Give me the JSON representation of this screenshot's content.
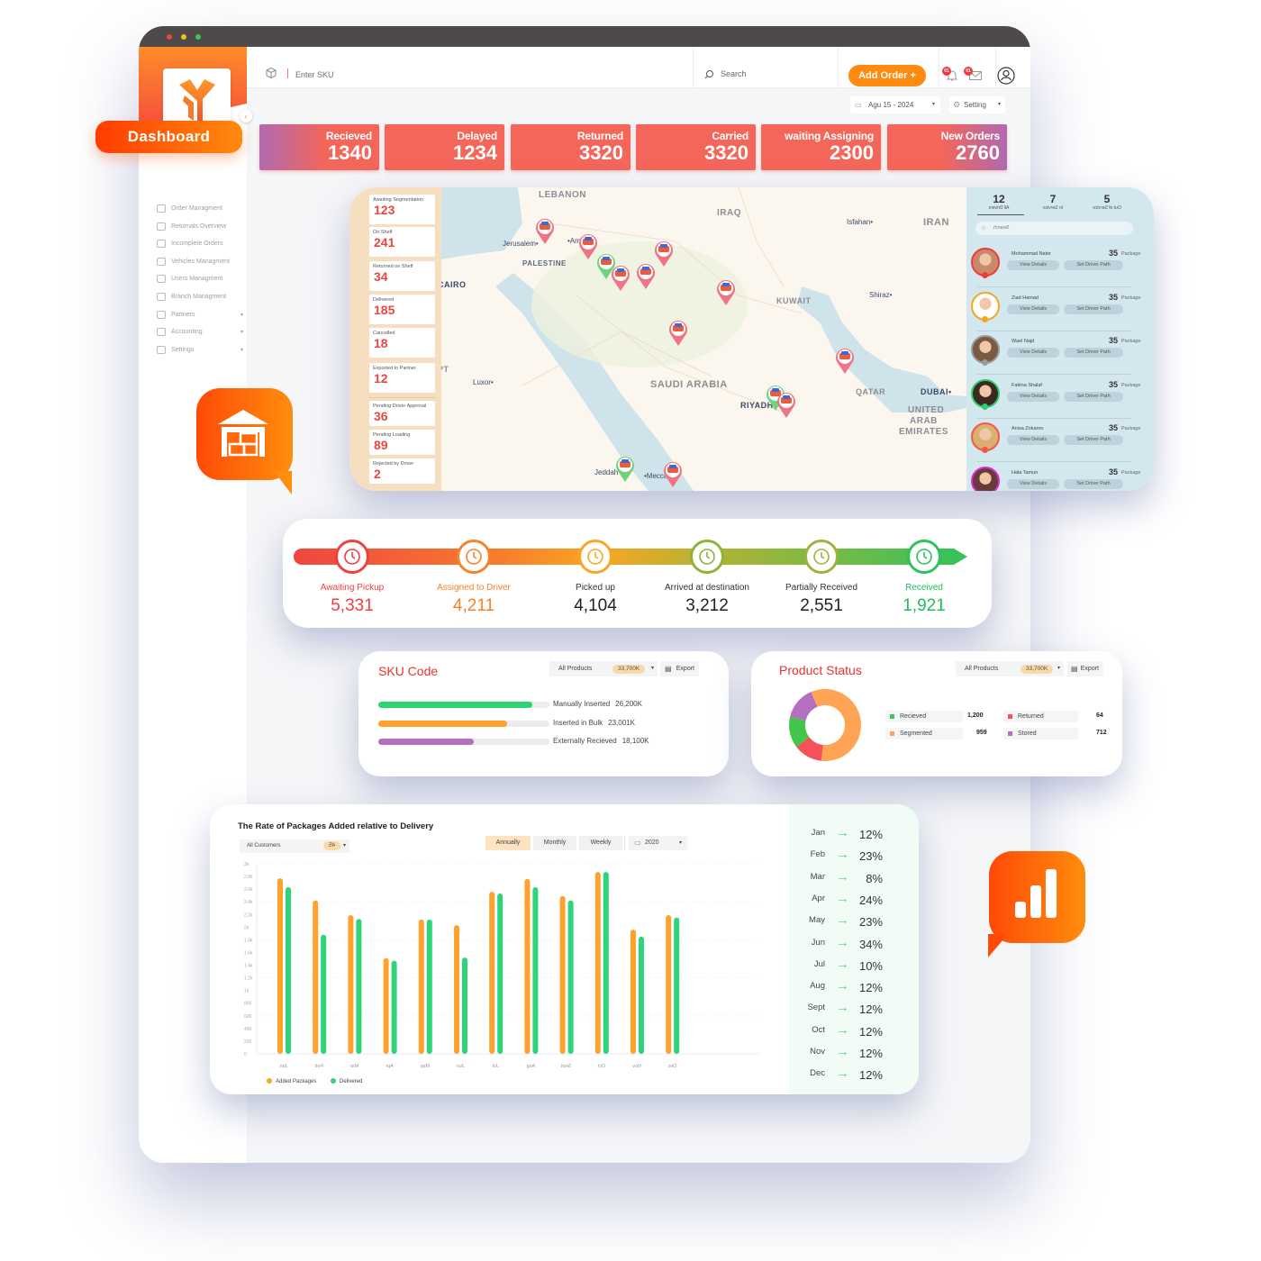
{
  "window": {
    "traffic_lights": [
      "#e94a3c",
      "#f2c21c",
      "#3dc653"
    ]
  },
  "brand": {
    "logo": "logo-y-mark",
    "dashboard_label": "Dashboard",
    "accent": "#ff8a10"
  },
  "sidebar": {
    "items": [
      {
        "label": "Order Managment",
        "icon": "list-icon"
      },
      {
        "label": "Returnals Overview",
        "icon": "return-box-icon"
      },
      {
        "label": "Incomplete Orders",
        "icon": "incomplete-icon"
      },
      {
        "label": "Vehicles Managment",
        "icon": "vehicle-icon"
      },
      {
        "label": "Users Managment",
        "icon": "users-icon"
      },
      {
        "label": "Branch Managment",
        "icon": "branch-icon"
      },
      {
        "label": "Partners",
        "icon": "partners-icon",
        "has_submenu": true
      },
      {
        "label": "Accounting",
        "icon": "accounting-icon",
        "has_submenu": true
      },
      {
        "label": "Settings",
        "icon": "settings-icon",
        "has_submenu": true
      }
    ]
  },
  "topbar": {
    "sku_placeholder": "Enter SKU",
    "search_placeholder": "Search",
    "add_order_label": "Add Order +",
    "notifications_badge": "01",
    "messages_badge": "01",
    "date_label": "Agu 15 - 2024",
    "setting_label": "Setting"
  },
  "stats": [
    {
      "label": "Recieved",
      "value": "1340"
    },
    {
      "label": "Delayed",
      "value": "1234"
    },
    {
      "label": "Returned",
      "value": "3320"
    },
    {
      "label": "Carried",
      "value": "3320"
    },
    {
      "label": "waiting Assigning",
      "value": "2300"
    },
    {
      "label": "New Orders",
      "value": "2760"
    }
  ],
  "order_status": [
    {
      "label": "Awaiting Segmentation",
      "value": "123"
    },
    {
      "label": "On Shelf",
      "value": "241"
    },
    {
      "label": "Returned on Shelf",
      "value": "34"
    },
    {
      "label": "Delivered",
      "value": "185"
    },
    {
      "label": "Cancelled",
      "value": "18"
    },
    {
      "label": "Exported to Partner",
      "value": "12"
    },
    {
      "label": "Pending Driver Approval",
      "value": "36"
    },
    {
      "label": "Pending Loading",
      "value": "89"
    },
    {
      "label": "Rejected by Driver",
      "value": "2"
    }
  ],
  "map": {
    "labels": [
      "LEBANON",
      "IRAQ",
      "IRAN",
      "Isfahan",
      "Jerusalem",
      "Amman",
      "PALESTINE",
      "CAIRO",
      "KUWAIT",
      "Shiraz",
      "EGYPT",
      "Luxor",
      "SAUDI ARABIA",
      "RIYADH",
      "QATAR",
      "DUBAI",
      "UNITED",
      "ARAB",
      "EMIRATES",
      "Jeddah",
      "Mecca"
    ],
    "markers": [
      {
        "status": "active",
        "color": "#f07486"
      },
      {
        "status": "active",
        "color": "#f07486"
      },
      {
        "status": "available",
        "color": "#6ed47e"
      },
      {
        "status": "active",
        "color": "#f07486"
      },
      {
        "status": "active",
        "color": "#f07486"
      },
      {
        "status": "active",
        "color": "#f07486"
      },
      {
        "status": "active",
        "color": "#f07486"
      },
      {
        "status": "active",
        "color": "#f07486"
      },
      {
        "status": "active",
        "color": "#f07486"
      },
      {
        "status": "available",
        "color": "#6ed47e"
      },
      {
        "status": "active",
        "color": "#f07486"
      },
      {
        "status": "available",
        "color": "#6ed47e"
      },
      {
        "status": "active",
        "color": "#f07486"
      }
    ]
  },
  "drivers": {
    "tabs": [
      {
        "count": "12",
        "label": "All Drivers"
      },
      {
        "count": "7",
        "label": "In Service"
      },
      {
        "count": "5",
        "label": "Out of Service"
      }
    ],
    "search_placeholder": "Search",
    "view_details_label": "View Details",
    "set_path_label": "Set Driver Path",
    "package_unit": "Package",
    "list": [
      {
        "name": "Mohammad Nater",
        "packages": "35",
        "status_color": "#ee3b3b"
      },
      {
        "name": "Ziad Hamad",
        "packages": "35",
        "status_color": "#f5a623"
      },
      {
        "name": "Wael Najd",
        "packages": "35",
        "status_color": "#9a9a9a"
      },
      {
        "name": "Fatima Shalaf",
        "packages": "35",
        "status_color": "#2ecc71"
      },
      {
        "name": "Anisa Zokarno",
        "packages": "35",
        "status_color": "#f5564a"
      },
      {
        "name": "Hala Tamun",
        "packages": "35",
        "status_color": "#d42fd4"
      }
    ]
  },
  "pipeline": [
    {
      "label": "Awaiting Pickup",
      "value": "5,331",
      "color": "#ef3f3f",
      "icon": "clock-history-icon"
    },
    {
      "label": "Assigned to Driver",
      "value": "4,211",
      "color": "#f7822a",
      "icon": "driver-assign-icon"
    },
    {
      "label": "Picked up",
      "value": "4,104",
      "color": "#222222",
      "icon": "pickup-truck-icon"
    },
    {
      "label": "Arrived at destination",
      "value": "3,212",
      "color": "#222222",
      "icon": "route-pin-icon"
    },
    {
      "label": "Partially Received",
      "value": "2,551",
      "color": "#222222",
      "icon": "battery-icon"
    },
    {
      "label": "Received",
      "value": "1,921",
      "color": "#1fbf5a",
      "icon": "package-check-icon"
    }
  ],
  "sku_card": {
    "title": "SKU Code",
    "filter_label": "All Products",
    "filter_count": "33,700K",
    "export_label": "Export",
    "bars": [
      {
        "label": "Manually Inserted",
        "value": "26,200K",
        "fraction": 0.9,
        "color": "#2ed46f"
      },
      {
        "label": "Inserted in Bulk",
        "value": "23,001K",
        "fraction": 0.75,
        "color": "#ffa12b"
      },
      {
        "label": "Externally Recieved",
        "value": "18,100K",
        "fraction": 0.56,
        "color": "#b56fbf"
      }
    ]
  },
  "product_status": {
    "title": "Product Status",
    "filter_label": "All Products",
    "filter_count": "33,700K",
    "export_label": "Export",
    "items": [
      {
        "label": "Recieved",
        "value": "1,200",
        "num": 1200,
        "color": "#43c54b"
      },
      {
        "label": "Returned",
        "value": "64",
        "num": 64,
        "color": "#f4515a"
      },
      {
        "label": "Segmented",
        "value": "959",
        "num": 959,
        "color": "#ffa455"
      },
      {
        "label": "Stored",
        "value": "712",
        "num": 712,
        "color": "#b56fbf"
      }
    ],
    "donut_shares": [
      {
        "label": "Segmented",
        "percent": 58,
        "color": "#ffa455"
      },
      {
        "label": "Returned",
        "percent": 13,
        "color": "#f4515a"
      },
      {
        "label": "Recieved",
        "percent": 14,
        "color": "#43c54b"
      },
      {
        "label": "Stored",
        "percent": 15,
        "color": "#b56fbf"
      }
    ]
  },
  "chart_controls": {
    "customer_filter": "All Customers",
    "customer_count": "45",
    "periods": [
      "Annually",
      "Monthly",
      "Weekly"
    ],
    "active_period": "Annually",
    "year": "2020"
  },
  "chart_data": {
    "type": "bar",
    "title": "The Rate of Packages Added relative to Delivery",
    "xlabel": "",
    "ylabel": "",
    "ylim": [
      0,
      3000
    ],
    "yticks": [
      "0",
      "200",
      "400",
      "600",
      "800",
      "1k",
      "1.2k",
      "1.4k",
      "1.6k",
      "1.8k",
      "2k",
      "2.2k",
      "2.4k",
      "2.6k",
      "2.8k",
      "3k"
    ],
    "categories": [
      "Jan",
      "Feb",
      "Mar",
      "Apr",
      "May",
      "Jun",
      "Jul",
      "Aug",
      "Sept",
      "Oct",
      "Nov",
      "Dec"
    ],
    "series": [
      {
        "name": "Added Packages",
        "color": "#ffa12b",
        "values": [
          2770,
          2420,
          2190,
          1510,
          2120,
          2030,
          2560,
          2760,
          2490,
          2870,
          1960,
          2190
        ]
      },
      {
        "name": "Delivered",
        "color": "#2ed47a",
        "values": [
          2630,
          1880,
          2130,
          1470,
          2120,
          1520,
          2530,
          2630,
          2420,
          2870,
          1850,
          2150
        ]
      }
    ],
    "legend": "bottom-left",
    "grid": true
  },
  "monthly_rates": [
    {
      "month": "Jan",
      "rate": "12%"
    },
    {
      "month": "Feb",
      "rate": "23%"
    },
    {
      "month": "Mar",
      "rate": "8%"
    },
    {
      "month": "Apr",
      "rate": "24%"
    },
    {
      "month": "May",
      "rate": "23%"
    },
    {
      "month": "Jun",
      "rate": "34%"
    },
    {
      "month": "Jul",
      "rate": "10%"
    },
    {
      "month": "Aug",
      "rate": "12%"
    },
    {
      "month": "Sept",
      "rate": "12%"
    },
    {
      "month": "Oct",
      "rate": "12%"
    },
    {
      "month": "Nov",
      "rate": "12%"
    },
    {
      "month": "Dec",
      "rate": "12%"
    }
  ],
  "decor": {
    "warehouse_bubble_icon": "warehouse-icon",
    "chart_bubble_icon": "bar-chart-icon"
  }
}
